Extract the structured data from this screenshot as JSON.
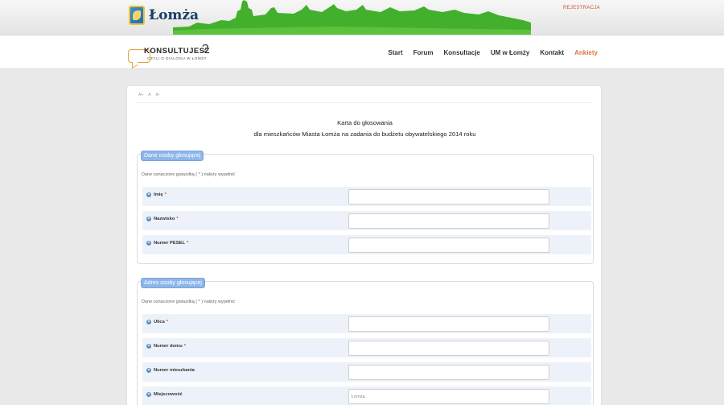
{
  "header": {
    "logo_text": "Łomża",
    "register_link": "REJESTRACJA"
  },
  "brand": {
    "title": "KONSULTUJESZ",
    "question_mark": "?",
    "subtitle": "CZYLI O DIALOGU W ŁOMŻY"
  },
  "nav": {
    "items": [
      "Start",
      "Forum",
      "Konsultacje",
      "UM w Łomży",
      "Kontakt",
      "Ankiety"
    ],
    "active": "Ankiety"
  },
  "toolbar": {
    "icons": [
      "font-increase-icon",
      "font-reset-icon",
      "font-decrease-icon"
    ],
    "labels": [
      "A+",
      "A",
      "A-"
    ]
  },
  "form": {
    "title_line1": "Karta do głosowania",
    "title_line2": "dla mieszkańców Miasta Łomża na zadania do budżetu obywatelskiego 2014 roku",
    "sections": [
      {
        "legend": "Dane osoby głosującej",
        "note": "Dane oznaczone gwiazdką ( * ) należy wypełnić",
        "fields": [
          {
            "label": "Imię",
            "required": "*",
            "value": ""
          },
          {
            "label": "Nazwisko",
            "required": "*",
            "value": ""
          },
          {
            "label": "Numer PESEL",
            "required": "*",
            "value": ""
          }
        ]
      },
      {
        "legend": "Adres osoby głosującej",
        "note": "Dane oznaczone gwiazdką ( * ) należy wypełnić",
        "fields": [
          {
            "label": "Ulica",
            "required": "*",
            "value": ""
          },
          {
            "label": "Numer domu",
            "required": "*",
            "value": ""
          },
          {
            "label": "Numer mieszkania",
            "required": "",
            "value": ""
          },
          {
            "label": "Miejscowość",
            "required": "",
            "value": "Łomża"
          }
        ]
      }
    ]
  },
  "colors": {
    "skyline_green": "#3fae2a",
    "legend_blue": "#8cb6ea",
    "active_nav": "#d77a3c",
    "row_bg": "#edf2fa"
  }
}
